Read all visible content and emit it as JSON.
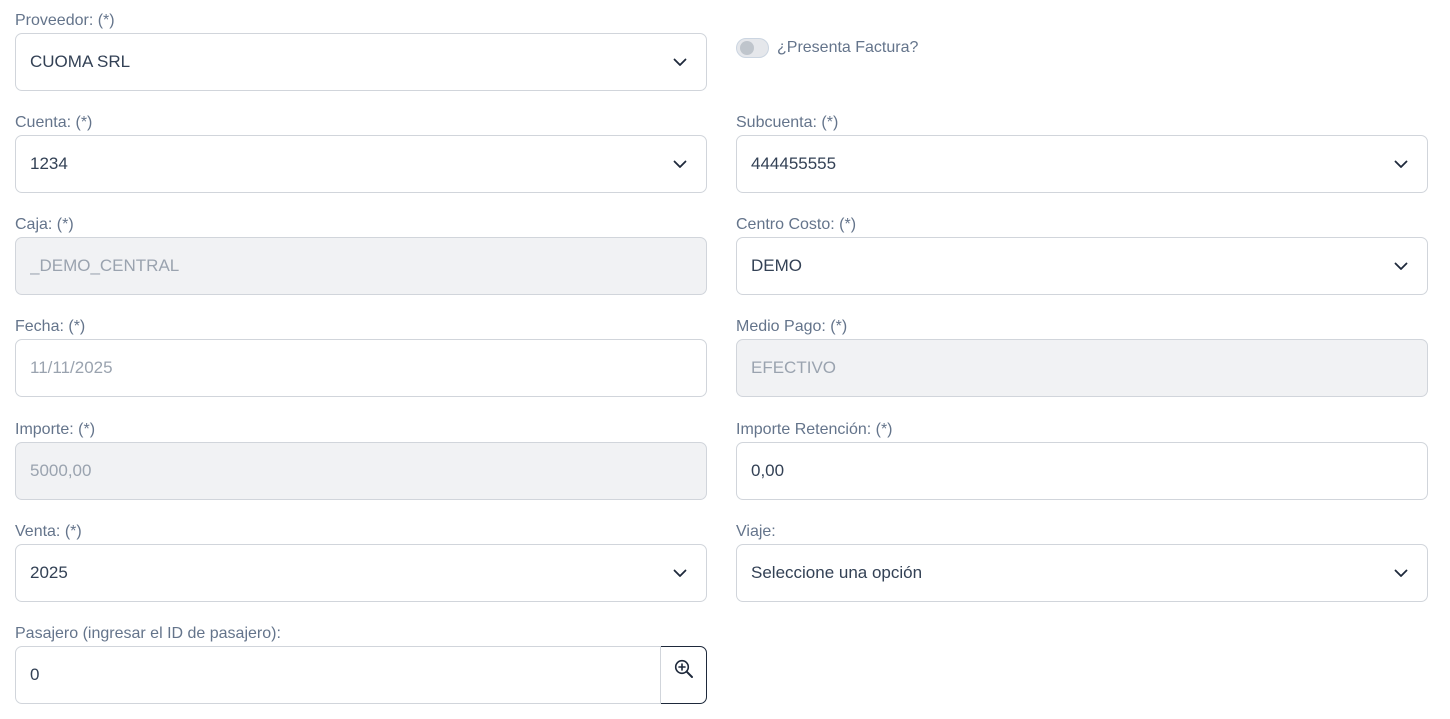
{
  "proveedor": {
    "label": "Proveedor: (*)",
    "value": "CUOMA SRL"
  },
  "presenta_factura": {
    "label": "¿Presenta Factura?",
    "checked": false
  },
  "cuenta": {
    "label": "Cuenta: (*)",
    "value": "1234"
  },
  "subcuenta": {
    "label": "Subcuenta: (*)",
    "value": "444455555"
  },
  "caja": {
    "label": "Caja: (*)",
    "value": "_DEMO_CENTRAL"
  },
  "centro_costo": {
    "label": "Centro Costo: (*)",
    "value": "DEMO"
  },
  "fecha": {
    "label": "Fecha: (*)",
    "value": "11/11/2025"
  },
  "medio_pago": {
    "label": "Medio Pago: (*)",
    "value": "EFECTIVO"
  },
  "importe": {
    "label": "Importe: (*)",
    "value": "5000,00"
  },
  "importe_retencion": {
    "label": "Importe Retención: (*)",
    "value": "0,00"
  },
  "venta": {
    "label": "Venta: (*)",
    "value": "2025"
  },
  "viaje": {
    "label": "Viaje:",
    "value": "Seleccione una opción"
  },
  "pasajero": {
    "label": "Pasajero (ingresar el ID de pasajero):",
    "value": "0",
    "button_icon": "zoom-in-icon"
  },
  "icons": {
    "dropdown": "chevron-down-icon"
  },
  "colors": {
    "label": "#64748b",
    "text": "#334155",
    "disabled_bg": "#f1f2f4",
    "border": "#d1d5db",
    "button_border": "#1e293b"
  }
}
